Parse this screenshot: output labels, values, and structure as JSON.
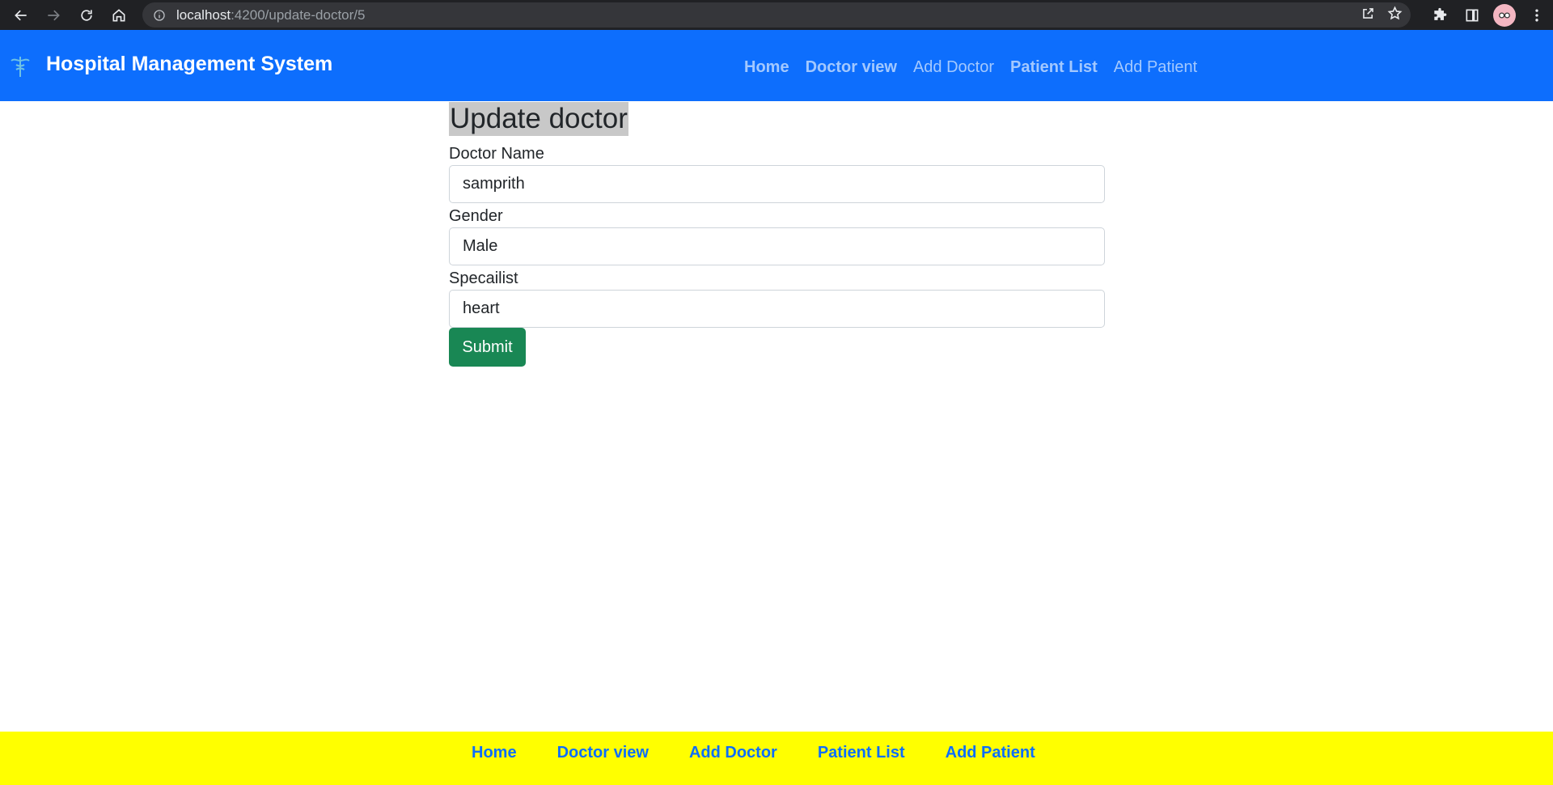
{
  "browser": {
    "url_host": "localhost",
    "url_path": ":4200/update-doctor/5",
    "icons": [
      "back-arrow-icon",
      "forward-arrow-icon",
      "reload-icon",
      "home-icon",
      "info-icon",
      "share-icon",
      "star-icon",
      "extensions-icon",
      "side-panel-icon",
      "profile-avatar",
      "kebab-menu-icon"
    ]
  },
  "navbar": {
    "brand_icon": "caduceus-icon",
    "brand": "Hospital Management System",
    "links": [
      "Home",
      "Doctor view",
      "Add Doctor",
      "Patient List",
      "Add Patient"
    ],
    "bg_color": "#0d6efd"
  },
  "form": {
    "title": "Update doctor",
    "fields": [
      {
        "label": "Doctor Name",
        "value": "samprith"
      },
      {
        "label": "Gender",
        "value": "Male"
      },
      {
        "label": "Specailist",
        "value": "heart"
      }
    ],
    "submit_label": "Submit",
    "submit_color": "#198754"
  },
  "footer": {
    "links": [
      "Home",
      "Doctor view",
      "Add Doctor",
      "Patient List",
      "Add Patient"
    ],
    "bg_color": "#ffff00"
  }
}
